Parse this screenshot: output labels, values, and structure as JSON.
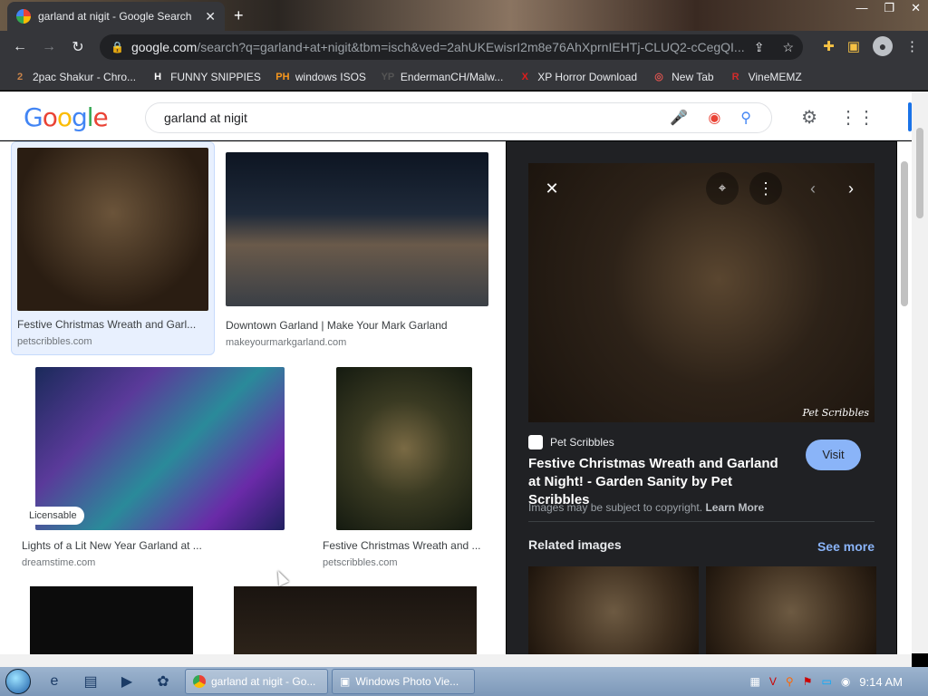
{
  "browser": {
    "tab_title": "garland at nigit - Google Search",
    "url_host": "google.com",
    "url_path": "/search?q=garland+at+nigit&tbm=isch&ved=2ahUKEwisrI2m8e76AhXprnIEHTj-CLUQ2-cCegQI...",
    "bookmarks": [
      {
        "icon": "2",
        "icon_color": "#c9844a",
        "label": "2pac Shakur - Chro..."
      },
      {
        "icon": "H",
        "icon_color": "#ffffff",
        "label": "FUNNY SNIPPIES"
      },
      {
        "icon": "PH",
        "icon_color": "#f7971d",
        "label": "windows ISOS"
      },
      {
        "icon": "YP",
        "icon_color": "#555555",
        "label": "EndermanCH/Malw..."
      },
      {
        "icon": "X",
        "icon_color": "#e01c1c",
        "label": "XP Horror Download"
      },
      {
        "icon": "◎",
        "icon_color": "#d9534f",
        "label": "New Tab"
      },
      {
        "icon": "R",
        "icon_color": "#d22b2b",
        "label": "VineMEMZ"
      }
    ]
  },
  "search": {
    "logo": [
      "G",
      "o",
      "o",
      "g",
      "l",
      "e"
    ],
    "query": "garland at nigit"
  },
  "results": [
    {
      "caption": "Festive Christmas Wreath and Garl...",
      "source": "petscribbles.com"
    },
    {
      "caption": "Downtown Garland | Make Your Mark Garland",
      "source": "makeyourmarkgarland.com"
    },
    {
      "caption": "Lights of a Lit New Year Garland at ...",
      "source": "dreamstime.com",
      "badge": "Licensable"
    },
    {
      "caption": "Festive Christmas Wreath and ...",
      "source": "petscribbles.com"
    }
  ],
  "panel": {
    "source_name": "Pet Scribbles",
    "title": "Festive Christmas Wreath and Garland at Night! - Garden Sanity by Pet Scribbles",
    "visit_label": "Visit",
    "copyright_text": "Images may be subject to copyright.",
    "learn_more": "Learn More",
    "related_heading": "Related images",
    "see_more": "See more",
    "watermark": "Pet Scribbles"
  },
  "taskbar": {
    "tasks": [
      "garland at nigit - Go...",
      "Windows Photo Vie..."
    ],
    "clock": "9:14 AM"
  }
}
